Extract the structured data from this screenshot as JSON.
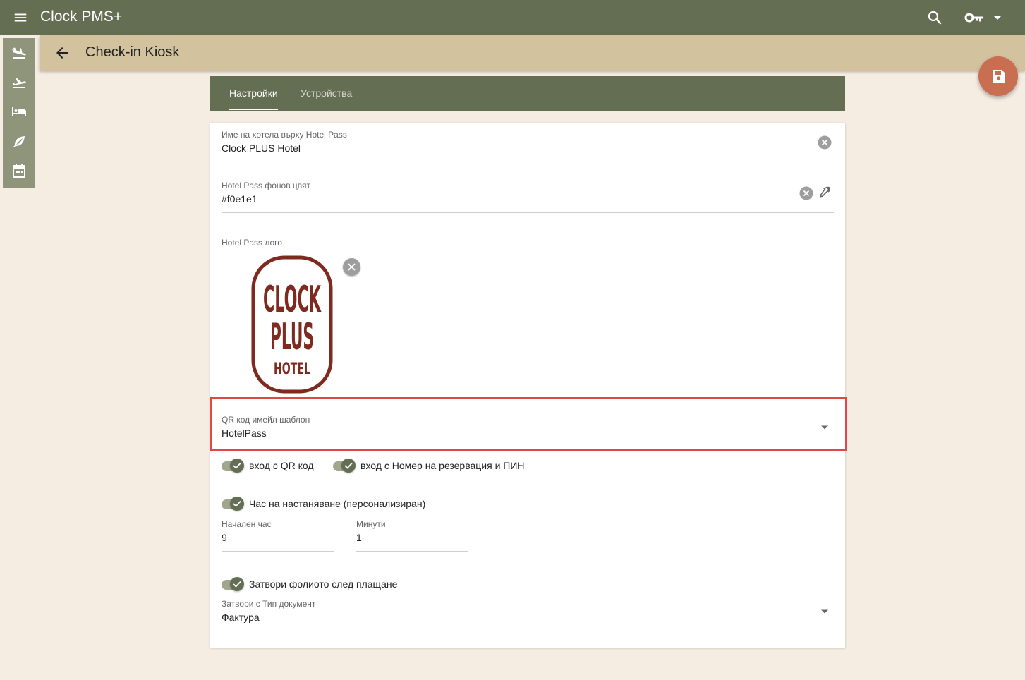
{
  "app": {
    "title": "Clock PMS+"
  },
  "header": {
    "page_title": "Check-in Kiosk"
  },
  "tabs": [
    {
      "label": "Настройки",
      "active": true
    },
    {
      "label": "Устройства",
      "active": false
    }
  ],
  "form": {
    "hotel_name": {
      "label": "Име на хотела върху Hotel Pass",
      "value": "Clock PLUS Hotel"
    },
    "bg_color": {
      "label": "Hotel Pass фонов цвят",
      "value": "#f0e1e1"
    },
    "logo": {
      "label": "Hotel Pass лого",
      "lines": [
        "CLOCK",
        "PLUS",
        "HOTEL"
      ]
    },
    "qr_template": {
      "label": "QR код имейл шаблон",
      "value": "HotelPass"
    },
    "toggles": {
      "qr_login": {
        "label": "вход с QR код",
        "on": true
      },
      "res_pin_login": {
        "label": "вход с Номер на резервация и ПИН",
        "on": true
      },
      "arrival_time": {
        "label": "Час на настаняване (персонализиран)",
        "on": true
      },
      "close_folio": {
        "label": "Затвори фолиото след плащане",
        "on": true
      }
    },
    "start_hour": {
      "label": "Начален час",
      "value": "9"
    },
    "minutes": {
      "label": "Минути",
      "value": "1"
    },
    "doc_type": {
      "label": "Затвори с Тип документ",
      "value": "Фактура"
    }
  },
  "colors": {
    "toolbar": "#636e52",
    "subheader": "#d3c29e",
    "background": "#f5ece2",
    "fab": "#c96e50",
    "logo": "#7e2a1e",
    "highlight": "#e04848"
  },
  "icons": {
    "menu": "menu-icon",
    "search": "search-icon",
    "key": "key-icon",
    "back": "arrow-back-icon",
    "save": "save-icon",
    "clear": "clear-circle-icon",
    "eyedropper": "eyedropper-icon",
    "dropdown": "dropdown-arrow-icon"
  }
}
